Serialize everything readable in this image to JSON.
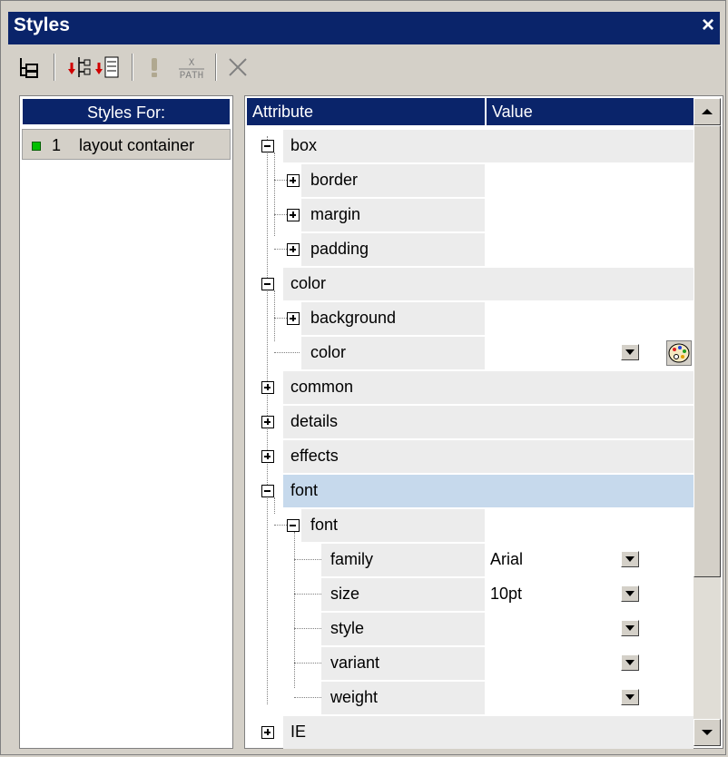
{
  "window": {
    "title": "Styles",
    "close": "×"
  },
  "toolbar": {
    "xpath_top": "X",
    "xpath_bottom": "PATH"
  },
  "left": {
    "header": "Styles For:",
    "items": [
      {
        "index": "1",
        "label": "layout container"
      }
    ]
  },
  "right": {
    "attr_header": "Attribute",
    "value_header": "Value",
    "rows": [
      {
        "label": "box",
        "value": ""
      },
      {
        "label": "border",
        "value": ""
      },
      {
        "label": "margin",
        "value": ""
      },
      {
        "label": "padding",
        "value": ""
      },
      {
        "label": "color",
        "value": ""
      },
      {
        "label": "background",
        "value": ""
      },
      {
        "label": "color",
        "value": ""
      },
      {
        "label": "common",
        "value": ""
      },
      {
        "label": "details",
        "value": ""
      },
      {
        "label": "effects",
        "value": ""
      },
      {
        "label": "font",
        "value": ""
      },
      {
        "label": "font",
        "value": ""
      },
      {
        "label": "family",
        "value": "Arial"
      },
      {
        "label": "size",
        "value": "10pt"
      },
      {
        "label": "style",
        "value": ""
      },
      {
        "label": "variant",
        "value": ""
      },
      {
        "label": "weight",
        "value": ""
      },
      {
        "label": "IE",
        "value": ""
      }
    ]
  },
  "colors": {
    "header": "#0a246a",
    "group_row": "#ececec",
    "selected_row": "#c6d9ec",
    "status_dot": "#00c000"
  }
}
